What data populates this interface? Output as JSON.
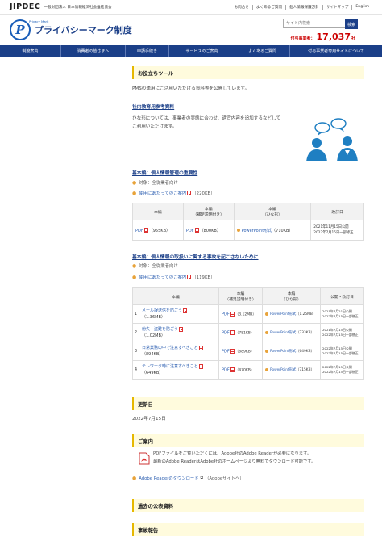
{
  "header": {
    "org_logo": "JIPDEC",
    "org_name": "一般財団法人 日本情報経済社会推進協会",
    "top_links": [
      "お問合せ",
      "よくあるご質問",
      "個人情報保護方針",
      "サイトマップ",
      "English"
    ],
    "brand_sub": "Privacy Mark",
    "brand_title": "プライバシーマーク制度",
    "search_placeholder": "サイト内検索",
    "search_button": "検索",
    "count_label": "付与事業者：",
    "count_value": "17,037",
    "count_unit": "社"
  },
  "nav": [
    "制度案内",
    "消費者の皆さまへ",
    "申請手続き",
    "サービスのご案内",
    "よくあるご質問",
    "付与事業者専用サイトについて"
  ],
  "tools": {
    "heading": "お役立ちツール",
    "intro": "PMSの運用にご活用いただける資料等を公開しています。",
    "edu_heading": "社内教育用参考資料",
    "edu_text_1": "ひな形については、事業者の実態に合わせ、適宜内容を追加するなどして",
    "edu_text_2": "ご利用いただけます。"
  },
  "basic1": {
    "title": "基本編：個人情報管理の重要性",
    "target": "対象：全従業者向け",
    "notes_link": "使用にあたってのご案内",
    "notes_size": "（220KB）",
    "headers": [
      "本編",
      "本編\n（補足説明付き）",
      "本編\n（ひな形）",
      "改訂日"
    ],
    "row": {
      "c1_link": "PDF",
      "c1_size": "（955KB）",
      "c2_link": "PDF",
      "c2_size": "（800KB）",
      "c3_link": "PowerPoint形式",
      "c3_size": "（710KB）",
      "rev_1": "2021年11月15日公開",
      "rev_2": "2022年7月15日一部修正"
    }
  },
  "basic2": {
    "title": "基本編：個人情報の取扱いに関する事故を起こさないために",
    "target": "対象：全従業者向け",
    "notes_link": "使用にあたってのご案内",
    "notes_size": "（119KB）",
    "headers": [
      "本編",
      "本編\n（補足説明付き）",
      "本編\n（ひな形）",
      "公開・改訂日"
    ],
    "rows": [
      {
        "num": "1",
        "title": "メール誤送信を防ごう",
        "size": "（1.36MB）",
        "c2": "PDF",
        "c2_size": "（3.12MB）",
        "c3": "PowerPoint形式",
        "c3_size": "（1.25MB）",
        "rev_1": "2021年7月21日公開",
        "rev_2": "2022年7月15日一部修正"
      },
      {
        "num": "2",
        "title": "紛失・盗難を防ごう",
        "size": "（1.02MB）",
        "c2": "PDF",
        "c2_size": "（781KB）",
        "c3": "PowerPoint形式",
        "c3_size": "（733KB）",
        "rev_1": "2021年7月15日公開",
        "rev_2": "2022年7月15日一部修正"
      },
      {
        "num": "3",
        "title": "日常業務の中で注意すべきこと",
        "size": "（894KB）",
        "c2": "PDF",
        "c2_size": "（689KB）",
        "c3": "PowerPoint形式",
        "c3_size": "（649KB）",
        "rev_1": "2022年7月15日公開",
        "rev_2": "2022年7月15日一部修正"
      },
      {
        "num": "4",
        "title": "テレワーク時に注意すべきこと",
        "size": "（649KB）",
        "c2": "PDF",
        "c2_size": "（470KB）",
        "c3": "PowerPoint形式",
        "c3_size": "（715KB）",
        "rev_1": "2022年7月15日公開",
        "rev_2": "2022年7月15日一部修正"
      }
    ]
  },
  "updated": {
    "heading": "更新日",
    "date": "2022年7月15日"
  },
  "guide": {
    "heading": "ご案内",
    "line1": "PDFファイルをご覧いただくには、Adobe社のAdobe Readerが必要になります。",
    "line2": "最新のAdobe ReaderはAdobe社のホームページより無料でダウンロード可能です。",
    "download_link": "Adobe Readerのダウンロード",
    "download_note": "（Adobeサイトへ）"
  },
  "past": {
    "heading": "過去の公表資料"
  },
  "incident": {
    "heading": "事故報告"
  },
  "colors": {
    "navy": "#1b3f88",
    "accent_red": "#cc0000",
    "heading_bg": "#fffbdd",
    "link": "#2a5db0"
  }
}
